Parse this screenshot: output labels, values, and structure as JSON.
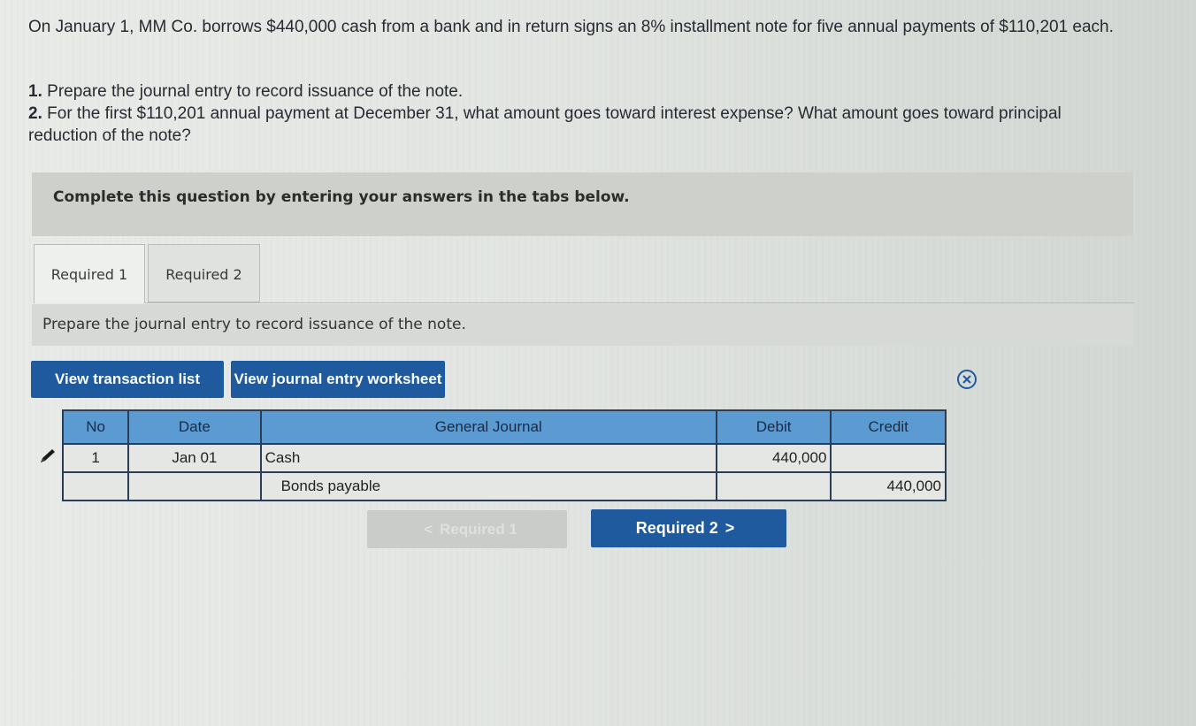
{
  "problem": {
    "intro": "On January 1, MM Co. borrows $440,000 cash from a bank and in return signs an 8% installment note for five annual payments of $110,201 each.",
    "q1_num": "1.",
    "q1_text": "Prepare the journal entry to record issuance of the note.",
    "q2_num": "2.",
    "q2_text": "For the first $110,201 annual payment at December 31, what amount goes toward interest expense? What amount goes toward principal reduction of the note?"
  },
  "banner": {
    "text": "Complete this question by entering your answers in the tabs below."
  },
  "tabs": [
    {
      "label": "Required 1",
      "active": true
    },
    {
      "label": "Required 2",
      "active": false
    }
  ],
  "instruction": "Prepare the journal entry to record issuance of the note.",
  "buttons": {
    "view_transaction_list": "View transaction list",
    "view_journal_worksheet": "View journal entry worksheet"
  },
  "journal": {
    "headers": {
      "no": "No",
      "date": "Date",
      "account": "General Journal",
      "debit": "Debit",
      "credit": "Credit"
    },
    "rows": [
      {
        "no": "1",
        "date": "Jan 01",
        "account": "Cash",
        "debit": "440,000",
        "credit": ""
      },
      {
        "no": "",
        "date": "",
        "account": "Bonds payable",
        "debit": "",
        "credit": "440,000"
      }
    ]
  },
  "navigation": {
    "prev_label": "Required 1",
    "prev_chevron": "<",
    "next_label": "Required 2",
    "next_chevron": ">"
  },
  "icons": {
    "close": "close-circle-icon",
    "edit": "pencil-icon"
  },
  "colors": {
    "primary_button": "#1f5a9e",
    "table_header": "#5b9bd1",
    "banner": "#cdd0cb"
  }
}
